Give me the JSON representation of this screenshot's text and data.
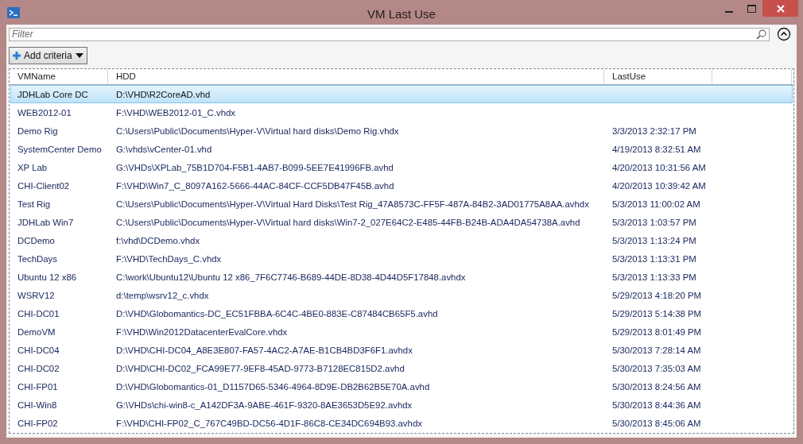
{
  "window": {
    "title": "VM Last Use"
  },
  "filter": {
    "placeholder": "Filter"
  },
  "add_criteria": {
    "label": "Add criteria"
  },
  "table": {
    "columns": [
      "VMName",
      "HDD",
      "LastUse"
    ],
    "rows": [
      {
        "vm": "JDHLab Core DC",
        "hdd": "D:\\VHD\\R2CoreAD.vhd",
        "selected": true
      },
      {
        "vm": "WEB2012-01",
        "hdd": "F:\\VHD\\WEB2012-01_C.vhdx",
        "selected": false
      },
      {
        "vm": "Demo Rig",
        "hdd": "C:\\Users\\Public\\Documents\\Hyper-V\\Virtual hard disks\\Demo Rig.vhdx",
        "last_use": "3/3/2013 2:32:17 PM",
        "selected": false
      },
      {
        "vm": "SystemCenter Demo",
        "hdd": "G:\\vhds\\vCenter-01.vhd",
        "last_use": "4/19/2013 8:32:51 AM",
        "selected": false
      },
      {
        "vm": "XP Lab",
        "hdd": "G:\\VHDs\\XPLab_75B1D704-F5B1-4AB7-B099-5EE7E41996FB.avhd",
        "last_use": "4/20/2013 10:31:56 AM",
        "selected": false
      },
      {
        "vm": "CHI-Client02",
        "hdd": "F:\\VHD\\Win7_C_8097A162-5666-44AC-84CF-CCF5DB47F45B.avhd",
        "last_use": "4/20/2013 10:39:42 AM",
        "selected": false
      },
      {
        "vm": "Test Rig",
        "hdd": "C:\\Users\\Public\\Documents\\Hyper-V\\Virtual Hard Disks\\Test Rig_47A8573C-FF5F-487A-84B2-3AD01775A8AA.avhdx",
        "last_use": "5/3/2013 11:00:02 AM",
        "selected": false
      },
      {
        "vm": "JDHLab Win7",
        "hdd": "C:\\Users\\Public\\Documents\\Hyper-V\\Virtual hard disks\\Win7-2_027E64C2-E485-44FB-B24B-ADA4DA54738A.avhd",
        "last_use": "5/3/2013 1:03:57 PM",
        "selected": false
      },
      {
        "vm": "DCDemo",
        "hdd": "f:\\vhd\\DCDemo.vhdx",
        "last_use": "5/3/2013 1:13:24 PM",
        "selected": false
      },
      {
        "vm": "TechDays",
        "hdd": "F:\\VHD\\TechDays_C.vhdx",
        "last_use": "5/3/2013 1:13:31 PM",
        "selected": false
      },
      {
        "vm": "Ubuntu 12 x86",
        "hdd": "C:\\work\\Ubuntu12\\Ubuntu 12 x86_7F6C7746-B689-44DE-8D38-4D44D5F17848.avhdx",
        "last_use": "5/3/2013 1:13:33 PM",
        "selected": false
      },
      {
        "vm": "WSRV12",
        "hdd": "d:\\temp\\wsrv12_c.vhdx",
        "last_use": "5/29/2013 4:18:20 PM",
        "selected": false
      },
      {
        "vm": "CHI-DC01",
        "hdd": "D:\\VHD\\Globomantics-DC_EC51FBBA-6C4C-4BE0-883E-C87484CB65F5.avhd",
        "last_use": "5/29/2013 5:14:38 PM",
        "selected": false
      },
      {
        "vm": "DemoVM",
        "hdd": "F:\\VHD\\Win2012DatacenterEvalCore.vhdx",
        "last_use": "5/29/2013 8:01:49 PM",
        "selected": false
      },
      {
        "vm": "CHI-DC04",
        "hdd": "D:\\VHD\\CHI-DC04_A8E3E807-FA57-4AC2-A7AE-B1CB4BD3F6F1.avhdx",
        "last_use": "5/30/2013 7:28:14 AM",
        "selected": false
      },
      {
        "vm": "CHI-DC02",
        "hdd": "D:\\VHD\\CHI-DC02_FCA99E77-9EF8-45AD-9773-B7128EC815D2.avhd",
        "last_use": "5/30/2013 7:35:03 AM",
        "selected": false
      },
      {
        "vm": "CHI-FP01",
        "hdd": "D:\\VHD\\Globomantics-01_D1157D65-5346-4964-8D9E-DB2B62B5E70A.avhd",
        "last_use": "5/30/2013 8:24:56 AM",
        "selected": false
      },
      {
        "vm": "CHI-Win8",
        "hdd": "G:\\VHDs\\chi-win8-c_A142DF3A-9ABE-461F-9320-8AE3653D5E92.avhdx",
        "last_use": "5/30/2013 8:44:36 AM",
        "selected": false
      },
      {
        "vm": "CHI-FP02",
        "hdd": "F:\\VHD\\CHI-FP02_C_767C49BD-DC56-4D1F-86C8-CE34DC694B93.avhdx",
        "last_use": "5/30/2013 8:45:06 AM",
        "selected": false
      }
    ]
  }
}
